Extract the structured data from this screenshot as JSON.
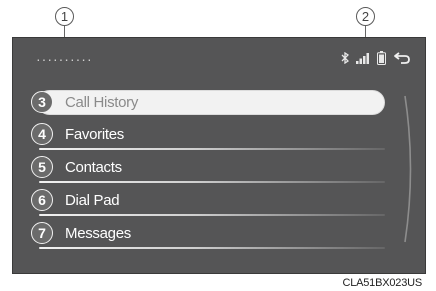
{
  "callouts": {
    "top_left": "1",
    "top_right": "2"
  },
  "header": {
    "title_placeholder": "··········",
    "icons": [
      "bluetooth-icon",
      "signal-strength-icon",
      "battery-icon",
      "back-icon"
    ]
  },
  "menu": {
    "items": [
      {
        "num": "3",
        "label": "Call History",
        "selected": true
      },
      {
        "num": "4",
        "label": "Favorites",
        "selected": false
      },
      {
        "num": "5",
        "label": "Contacts",
        "selected": false
      },
      {
        "num": "6",
        "label": "Dial Pad",
        "selected": false
      },
      {
        "num": "7",
        "label": "Messages",
        "selected": false
      }
    ]
  },
  "figure_code": "CLA51BX023US",
  "colors": {
    "screen_bg": "#555556",
    "selected_bg": "#f2f2f2",
    "text": "#ffffff"
  }
}
